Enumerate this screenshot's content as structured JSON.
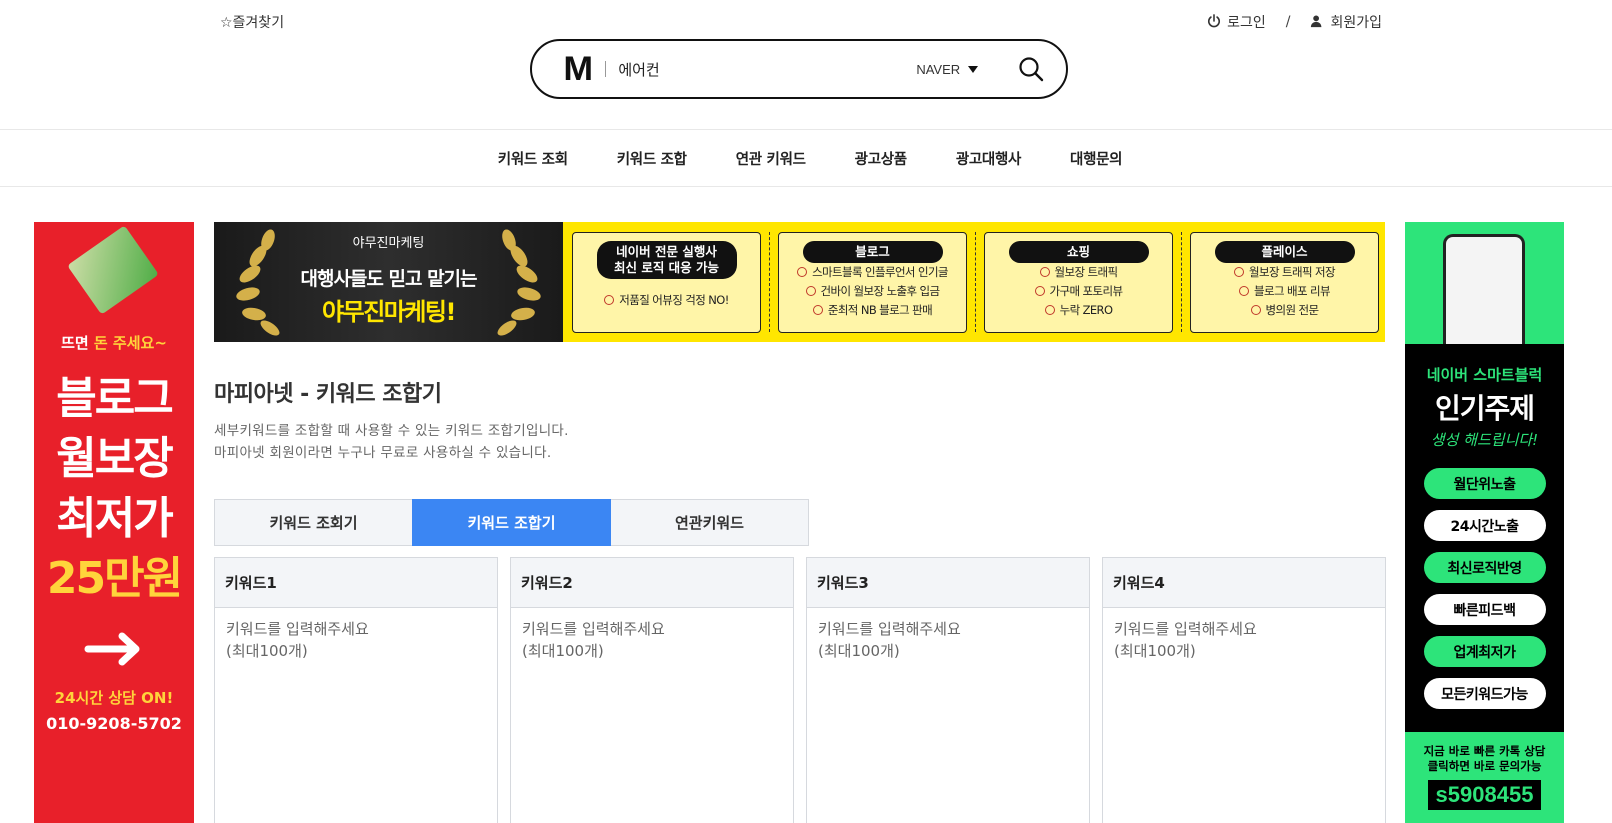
{
  "header": {
    "favorites": "☆즐겨찾기",
    "login": "로그인",
    "separator": "/",
    "signup": "회원가입"
  },
  "search": {
    "logo": "M",
    "query": "에어컨",
    "engine": "NAVER",
    "icon": "search-icon"
  },
  "nav": {
    "items": [
      "키워드 조회",
      "키워드 조합",
      "연관 키워드",
      "광고상품",
      "광고대행사",
      "대행문의"
    ]
  },
  "ad_left": {
    "line1_a": "뜨면 ",
    "line1_b": "돈 주세요~",
    "line2": "블로그",
    "line3": "월보장",
    "line4": "최저가",
    "line5": "25만원",
    "on": "24시간 상담 ON!",
    "phone": "010-9208-5702",
    "colors": {
      "bg": "#e8202a",
      "accent": "#ffd43b"
    }
  },
  "banner": {
    "brand": "야무진마케팅",
    "slogan": "대행사들도 믿고 맡기는",
    "name": "야무진마케팅!",
    "cards": [
      {
        "title": "네이버 전문 실행사\n최신 로직 대응 가능",
        "items": [
          "저품질 어뷰징 걱정 NO!"
        ]
      },
      {
        "title": "블로그",
        "items": [
          "스마트블록 인플루언서 인기글",
          "건바이 월보장 노출후 입금",
          "준최적 NB 블로그 판매"
        ]
      },
      {
        "title": "쇼핑",
        "items": [
          "월보장 트래픽",
          "가구매 포토리뷰",
          "누락 ZERO"
        ]
      },
      {
        "title": "플레이스",
        "items": [
          "월보장 트래픽 저장",
          "블로그 배포 리뷰",
          "병의원 전문"
        ]
      }
    ]
  },
  "ad_right": {
    "t1": "네이버 스마트블럭",
    "t2": "인기주제",
    "t3": "생성 해드립니다!",
    "pills": [
      "월단위노출",
      "24시간노출",
      "최신로직반영",
      "빠른피드백",
      "업계최저가",
      "모든키워드가능"
    ],
    "bottom1": "지금 바로 빠른 카톡 상담",
    "bottom2": "클릭하면 바로 문의가능",
    "code": "s5908455",
    "colors": {
      "accent": "#2de47a",
      "bg": "#000000"
    }
  },
  "page": {
    "title": "마피아넷 - 키워드 조합기",
    "desc1": "세부키워드를 조합할 때 사용할 수 있는 키워드 조합기입니다.",
    "desc2": "마피아넷 회원이라면 누구나 무료로 사용하실 수 있습니다."
  },
  "tabs": [
    "키워드 조회기",
    "키워드 조합기",
    "연관키워드"
  ],
  "active_tab": "키워드 조합기",
  "keywords": [
    {
      "label": "키워드1",
      "placeholder": "키워드를 입력해주세요\n(최대100개)"
    },
    {
      "label": "키워드2",
      "placeholder": "키워드를 입력해주세요\n(최대100개)"
    },
    {
      "label": "키워드3",
      "placeholder": "키워드를 입력해주세요\n(최대100개)"
    },
    {
      "label": "키워드4",
      "placeholder": "키워드를 입력해주세요\n(최대100개)"
    }
  ],
  "colors": {
    "accent": "#3b86f3",
    "banner_yellow": "#ffe600"
  }
}
